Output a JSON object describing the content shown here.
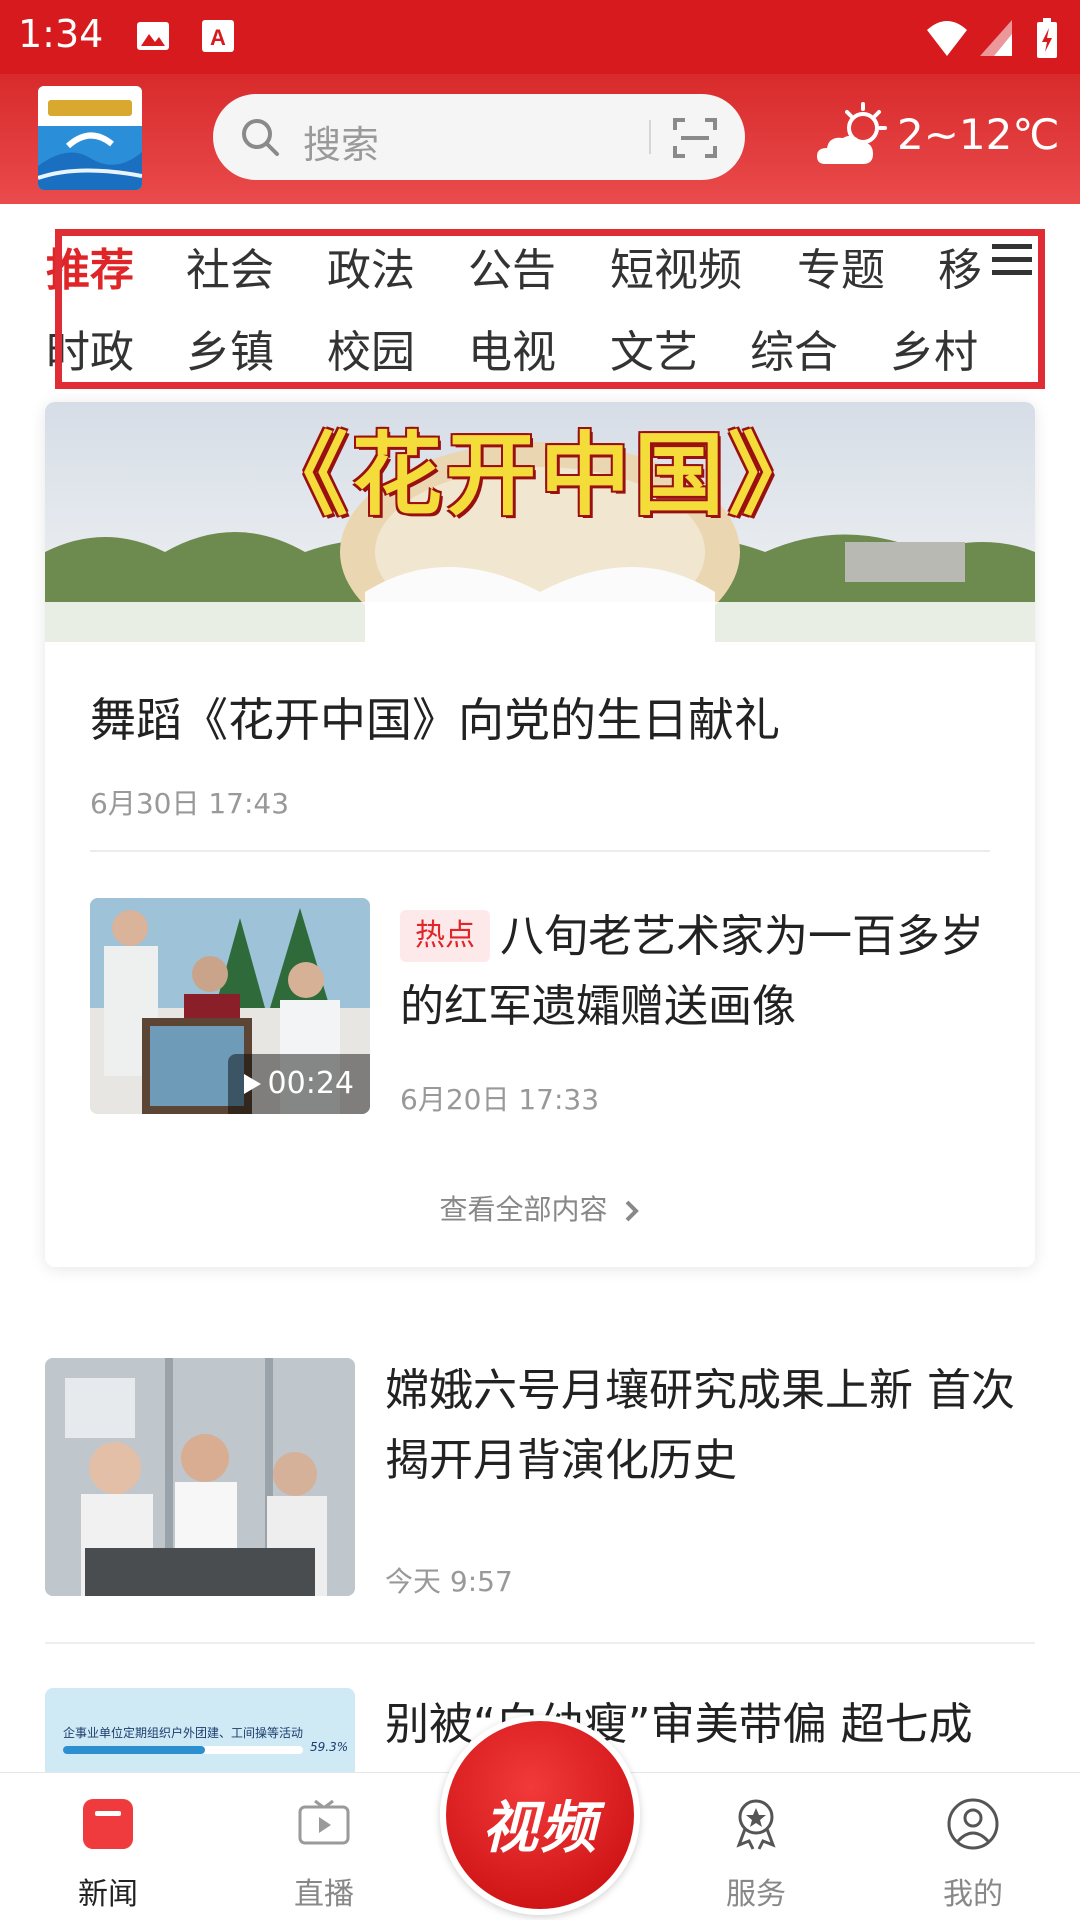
{
  "status_bar": {
    "time": "1:34"
  },
  "header": {
    "logo_alt": "饶干之窗",
    "search_placeholder": "搜索",
    "weather": {
      "temp": "2~12℃",
      "icon": "partly-cloudy-icon"
    }
  },
  "channels": {
    "row1": [
      "推荐",
      "社会",
      "政法",
      "公告",
      "短视频",
      "专题",
      "移"
    ],
    "row2": [
      "时政",
      "乡镇",
      "校园",
      "电视",
      "文艺",
      "综合",
      "乡村"
    ],
    "active": "推荐"
  },
  "featured": {
    "banner_text": "《花开中国》",
    "title": "舞蹈《花开中国》向党的生日献礼",
    "time": "6月30日 17:43",
    "news2": {
      "tag": "热点",
      "title": "八旬老艺术家为一百多岁的红军遗孀赠送画像",
      "time": "6月20日 17:33",
      "duration": "00:24"
    },
    "see_all": "查看全部内容"
  },
  "list": [
    {
      "title": "嫦娥六号月壤研究成果上新 首次揭开月背演化历史",
      "time": "今天 9:57"
    },
    {
      "title": "别被“白幼瘦”审美带偏 超七成",
      "thumb_text": "企事业单位定期组织户外团建、工间操等活动",
      "thumb_pct": "59.3%"
    }
  ],
  "tabbar": {
    "tabs": [
      "新闻",
      "直播",
      "视频",
      "服务",
      "我的"
    ],
    "active": "新闻"
  },
  "colors": {
    "brand_red": "#d61a1d",
    "accent": "#e02528"
  }
}
